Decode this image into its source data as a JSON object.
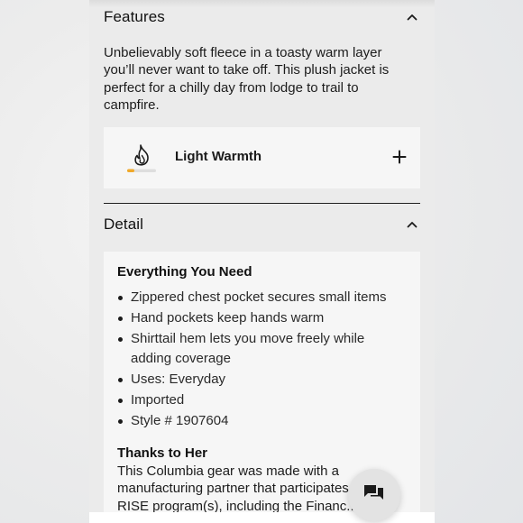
{
  "features": {
    "title": "Features",
    "description": "Unbelievably soft fleece in a toasty warm layer you’ll never want to take off. This plush jacket is perfect for a chilly day from lodge to trail to campfire.",
    "warmth": {
      "label": "Light Warmth",
      "icon": "flame-icon",
      "level": 0.25
    }
  },
  "detail": {
    "title": "Detail",
    "heading": "Everything You Need",
    "bullets": [
      "Zippered chest pocket secures small items",
      "Hand pockets keep hands warm",
      "Shirttail hem lets you move freely while adding coverage",
      "Uses: Everyday",
      "Imported",
      "Style # 1907604"
    ],
    "thanks_heading": "Thanks to Her",
    "thanks_text": "This Columbia gear was made with a manufacturing partner that participates in RISE program(s), including the Financ..."
  },
  "chat": {
    "icon": "chat-bubbles-icon"
  },
  "colors": {
    "accent": "#f0a92a",
    "background": "#ebebeb",
    "card": "#f6f6f6"
  }
}
